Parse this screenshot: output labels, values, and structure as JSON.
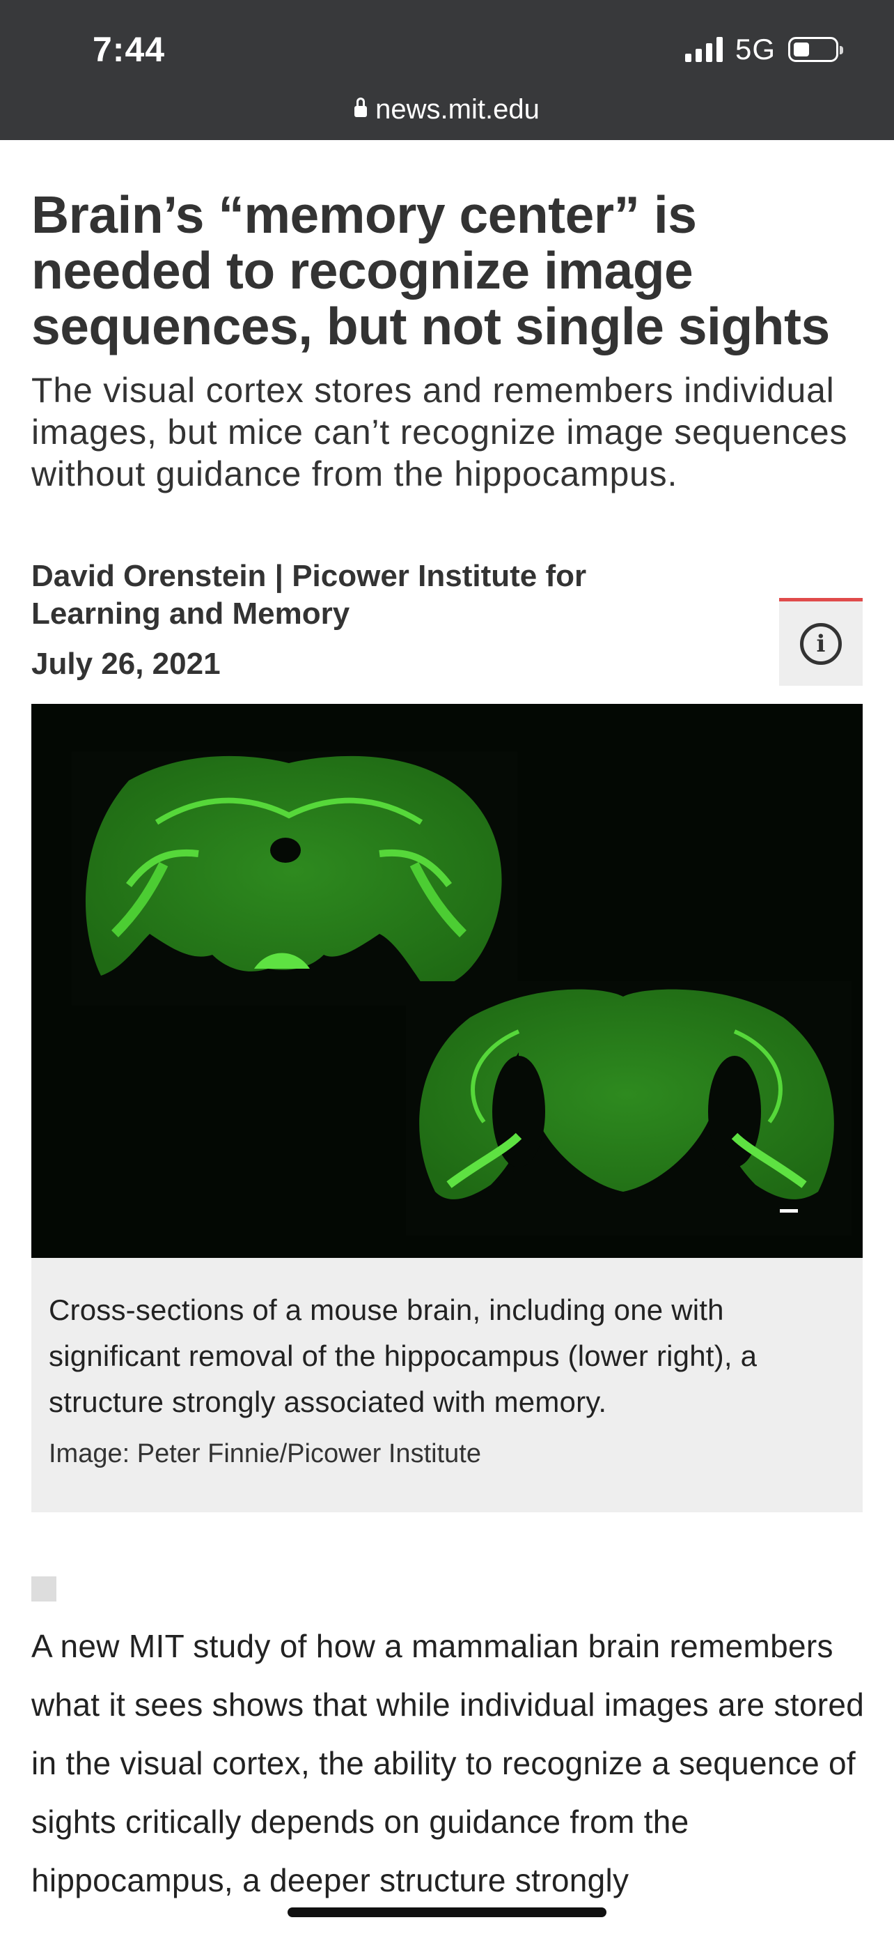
{
  "status_bar": {
    "time": "7:44",
    "network": "5G",
    "signal_bars": 4,
    "battery_level": 0.3
  },
  "browser": {
    "url": "news.mit.edu"
  },
  "article": {
    "title": "Brain’s “memory center” is needed to recognize image sequences, but not single sights",
    "subtitle": "The visual cortex stores and remembers individual images, but mice can’t recognize image sequences without guidance from the hippocampus.",
    "byline": "David Orenstein | Picower Institute for Learning and Memory",
    "date": "July 26, 2021",
    "info_icon": "info-icon",
    "figure": {
      "alt_icon": "brain-cross-section-image",
      "caption": "Cross-sections of a mouse brain, including one with significant removal of the hippocampus (lower right), a structure strongly associated with memory.",
      "credit": "Image: Peter Finnie/Picower Institute"
    },
    "body": "A new MIT study of how a mammalian brain remembers what it sees shows that while individual images are stored in the visual cortex, the ability to recognize a sequence of sights critically depends on guidance from the hippocampus, a deeper structure strongly"
  },
  "colors": {
    "topbar": "#38393b",
    "accent": "#e04b4b",
    "caption_bg": "#eeeeee",
    "stain": "#3fbf2a"
  }
}
